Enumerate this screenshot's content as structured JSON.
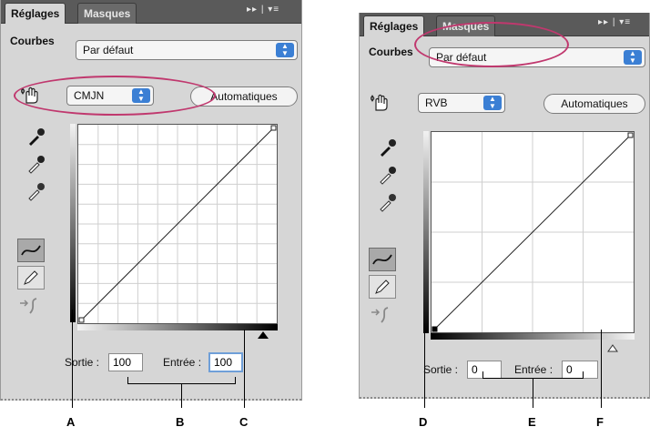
{
  "panel_left": {
    "tabs": {
      "active": "Réglages",
      "inactive": "Masques"
    },
    "header_icons": "▸▸ | ▾≡",
    "preset_label": "Courbes",
    "preset_value": "Par défaut",
    "channel_value": "CMJN",
    "auto_label": "Automatiques",
    "sortie_label": "Sortie :",
    "sortie_value": "100",
    "entree_label": "Entrée :",
    "entree_value": "100"
  },
  "panel_right": {
    "tabs": {
      "active": "Réglages",
      "inactive": "Masques"
    },
    "header_icons": "▸▸ | ▾≡",
    "preset_label": "Courbes",
    "preset_value": "Par défaut",
    "channel_value": "RVB",
    "auto_label": "Automatiques",
    "sortie_label": "Sortie :",
    "sortie_value": "0",
    "entree_label": "Entrée :",
    "entree_value": "0"
  },
  "callouts": [
    "A",
    "B",
    "C",
    "D",
    "E",
    "F"
  ],
  "colors": {
    "highlight": "#c0386e",
    "accent": "#3b7fd4"
  },
  "icons": [
    "hand-adjust-icon",
    "eyedropper-black-icon",
    "eyedropper-gray-icon",
    "eyedropper-white-icon",
    "curve-point-icon",
    "pencil-icon",
    "smooth-curve-icon",
    "black-point-slider-icon",
    "white-point-slider-icon"
  ]
}
